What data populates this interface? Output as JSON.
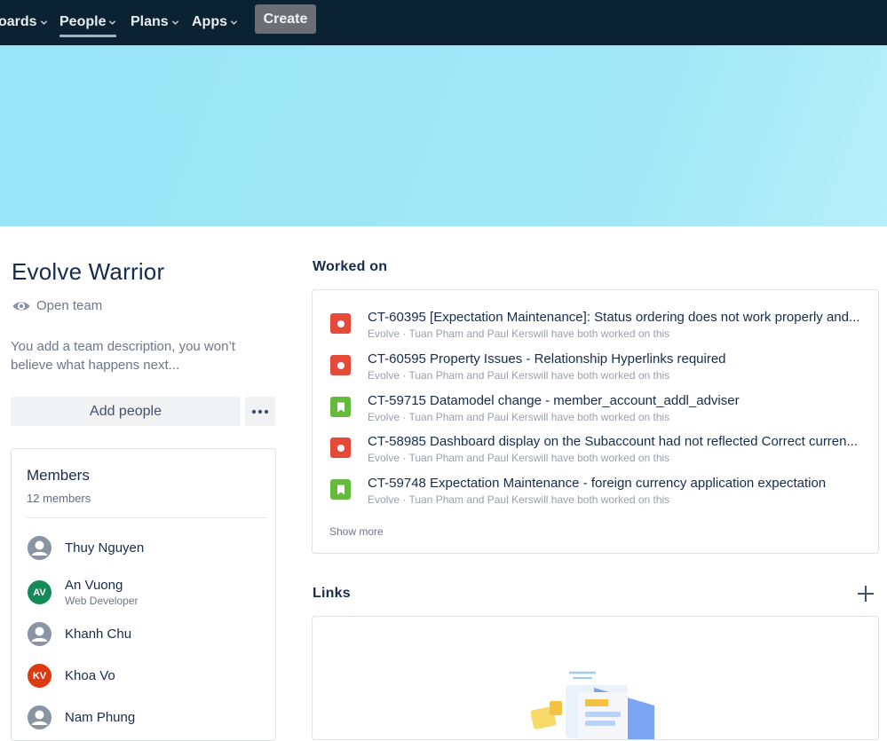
{
  "nav": {
    "items": [
      {
        "label": "oards",
        "active": false
      },
      {
        "label": "People",
        "active": true
      },
      {
        "label": "Plans",
        "active": false
      },
      {
        "label": "Apps",
        "active": false
      }
    ],
    "create_label": "Create"
  },
  "team": {
    "title": "Evolve Warrior",
    "visibility": "Open team",
    "description": "You add a team description, you won’t believe what happens next...",
    "add_people_label": "Add people"
  },
  "members": {
    "title": "Members",
    "count": "12 members",
    "list": [
      {
        "name": "Thuy Nguyen",
        "role": "",
        "initials": "",
        "color": "#8a94a4"
      },
      {
        "name": "An Vuong",
        "role": "Web Developer",
        "initials": "AV",
        "color": "#138a57"
      },
      {
        "name": "Khanh Chu",
        "role": "",
        "initials": "",
        "color": "#8a94a4"
      },
      {
        "name": "Khoa Vo",
        "role": "",
        "initials": "KV",
        "color": "#de3a12"
      },
      {
        "name": "Nam Phung",
        "role": "",
        "initials": "",
        "color": "#8a94a4"
      }
    ]
  },
  "worked_on": {
    "title": "Worked on",
    "items": [
      {
        "type": "bug",
        "title": "CT-60395 [Expectation Maintenance]: Status ordering does not work properly and...",
        "subtitle": "Evolve · Tuan Pham and Paul Kerswill have both worked on this"
      },
      {
        "type": "bug",
        "title": "CT-60595 Property Issues - Relationship Hyperlinks required",
        "subtitle": "Evolve · Tuan Pham and Paul Kerswill have both worked on this"
      },
      {
        "type": "story",
        "title": "CT-59715 Datamodel change - member_account_addl_adviser",
        "subtitle": "Evolve · Tuan Pham and Paul Kerswill have both worked on this"
      },
      {
        "type": "bug",
        "title": "CT-58985 Dashboard display on the Subaccount had not reflected Correct curren...",
        "subtitle": "Evolve · Tuan Pham and Paul Kerswill have both worked on this"
      },
      {
        "type": "story",
        "title": "CT-59748 Expectation Maintenance - foreign currency application expectation",
        "subtitle": "Evolve · Tuan Pham and Paul Kerswill have both worked on this"
      }
    ],
    "show_more": "Show more"
  },
  "links": {
    "title": "Links"
  },
  "colors": {
    "nav_bg": "#0b2232",
    "banner": "#98e6f6",
    "bug": "#e5493a",
    "story": "#63ba3c"
  }
}
